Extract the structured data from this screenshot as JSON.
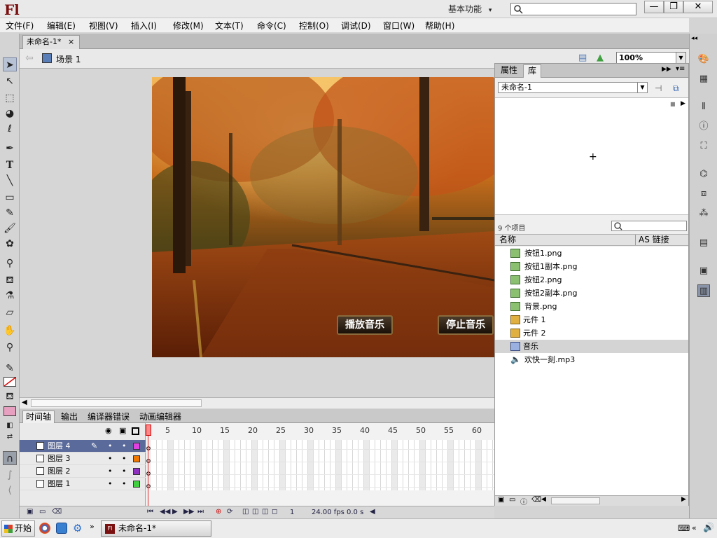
{
  "app": {
    "logo": "Fl",
    "workspace": "基本功能",
    "workspace_arrow": "▾"
  },
  "window_controls": {
    "minimize": "—",
    "restore": "❐",
    "close": "✕"
  },
  "menu": [
    "文件(F)",
    "编辑(E)",
    "视图(V)",
    "插入(I)",
    "修改(M)",
    "文本(T)",
    "命令(C)",
    "控制(O)",
    "调试(D)",
    "窗口(W)",
    "帮助(H)"
  ],
  "document": {
    "tab_label": "未命名-1*",
    "tab_close": "×",
    "scene": "场景 1",
    "zoom": "100%"
  },
  "stage": {
    "play_button": "播放音乐",
    "stop_button": "停止音乐"
  },
  "timeline": {
    "tabs": [
      "时间轴",
      "输出",
      "编译器错误",
      "动画编辑器"
    ],
    "frame_numbers": [
      "5",
      "10",
      "15",
      "20",
      "25",
      "30",
      "35",
      "40",
      "45",
      "50",
      "55",
      "60"
    ],
    "layers": [
      {
        "name": "图层 4",
        "color": "#e040e0",
        "selected": true
      },
      {
        "name": "图层 3",
        "color": "#f07800",
        "selected": false
      },
      {
        "name": "图层 2",
        "color": "#9030c0",
        "selected": false
      },
      {
        "name": "图层 1",
        "color": "#40d040",
        "selected": false
      }
    ],
    "status": {
      "frame": "1",
      "fps": "24.00 fps",
      "time": "0.0 s"
    }
  },
  "library": {
    "tabs": [
      "属性",
      "库"
    ],
    "doc": "未命名-1",
    "count": "9 个项目",
    "col_name": "名称",
    "col_link": "AS 链接",
    "items": [
      {
        "label": "按钮1.png",
        "icon": "bitmap-icon"
      },
      {
        "label": "按钮1副本.png",
        "icon": "bitmap-icon"
      },
      {
        "label": "按钮2.png",
        "icon": "bitmap-icon"
      },
      {
        "label": "按钮2副本.png",
        "icon": "bitmap-icon"
      },
      {
        "label": "背景.png",
        "icon": "bitmap-icon"
      },
      {
        "label": "元件 1",
        "icon": "button-symbol-icon"
      },
      {
        "label": "元件 2",
        "icon": "button-symbol-icon"
      },
      {
        "label": "音乐",
        "icon": "movieclip-icon",
        "selected": true
      },
      {
        "label": "欢快一刻.mp3",
        "icon": "sound-icon"
      }
    ]
  },
  "taskbar": {
    "start": "开始",
    "task": "未命名-1*"
  }
}
